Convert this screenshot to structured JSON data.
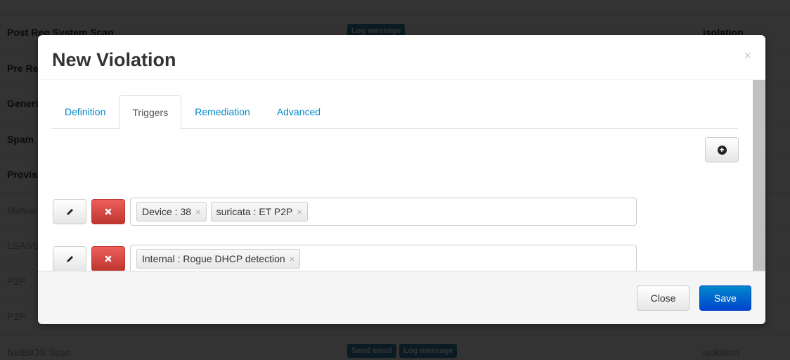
{
  "background": {
    "rows": [
      {
        "name": "Post Reg System Scan",
        "actions": [
          "Log message"
        ],
        "role": "isolation",
        "muted": false
      },
      {
        "name": "Pre Reg System Scan",
        "actions": [],
        "role": "",
        "muted": false
      },
      {
        "name": "Generic",
        "actions": [],
        "role": "",
        "muted": false
      },
      {
        "name": "Spam",
        "actions": [],
        "role": "",
        "muted": false
      },
      {
        "name": "Provisioning",
        "actions": [],
        "role": "",
        "muted": false
      },
      {
        "name": "Malware",
        "actions": [],
        "role": "",
        "muted": true
      },
      {
        "name": "LSASS",
        "actions": [],
        "role": "",
        "muted": true
      },
      {
        "name": "P2P",
        "actions": [],
        "role": "",
        "muted": true
      },
      {
        "name": "P2P",
        "actions": [],
        "role": "",
        "muted": true
      },
      {
        "name": "NetBIOS Scan",
        "actions": [
          "Send email",
          "Log message"
        ],
        "role": "isolation",
        "muted": true
      }
    ]
  },
  "modal": {
    "title": "New Violation",
    "close_glyph": "×",
    "tabs": [
      {
        "label": "Definition",
        "active": false
      },
      {
        "label": "Triggers",
        "active": true
      },
      {
        "label": "Remediation",
        "active": false
      },
      {
        "label": "Advanced",
        "active": false
      }
    ],
    "add_icon": "plus-circle-icon",
    "triggers": [
      {
        "tags": [
          {
            "label": "Device : 38"
          },
          {
            "label": "suricata : ET P2P"
          }
        ]
      },
      {
        "tags": [
          {
            "label": "Internal : Rogue DHCP detection"
          }
        ]
      }
    ],
    "footer": {
      "close_label": "Close",
      "save_label": "Save"
    }
  },
  "colors": {
    "tab_link": "#0088cc",
    "danger": "#bd362f",
    "primary": "#0044cc",
    "label_info": "#3a87ad"
  }
}
